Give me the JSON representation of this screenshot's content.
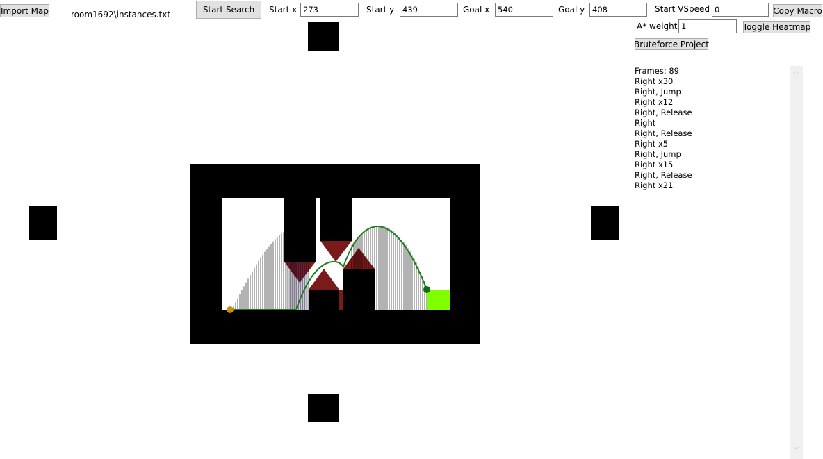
{
  "toolbar": {
    "import_label": "Import Map",
    "file_path": "room1692\\instances.txt",
    "start_search_label": "Start Search",
    "start_x_label": "Start x",
    "start_x_value": "273",
    "start_y_label": "Start y",
    "start_y_value": "439",
    "goal_x_label": "Goal x",
    "goal_x_value": "540",
    "goal_y_label": "Goal y",
    "goal_y_value": "408",
    "start_vspeed_label": "Start VSpeed",
    "start_vspeed_value": "0",
    "copy_macro_label": "Copy Macro",
    "astar_weight_label": "A* weight",
    "astar_weight_value": "1",
    "toggle_heatmap_label": "Toggle Heatmap",
    "bruteforce_label": "Bruteforce Project"
  },
  "macro": {
    "lines": [
      "Frames: 89",
      "Right x30",
      "Right, Jump",
      "Right x12",
      "Right, Release",
      "Right",
      "Right, Release",
      "Right x5",
      "Right, Jump",
      "Right x15",
      "Right, Release",
      "Right x21"
    ]
  },
  "colors": {
    "wall": "#000000",
    "spike": "#7b1a1a",
    "path": "#1a7f1a",
    "goal_block": "#80ff00",
    "start_marker": "#c8900a",
    "goal_marker": "#0f6e0f"
  },
  "icons": {
    "scroll_up": "chevron-up-icon",
    "scroll_down": "chevron-down-icon"
  }
}
